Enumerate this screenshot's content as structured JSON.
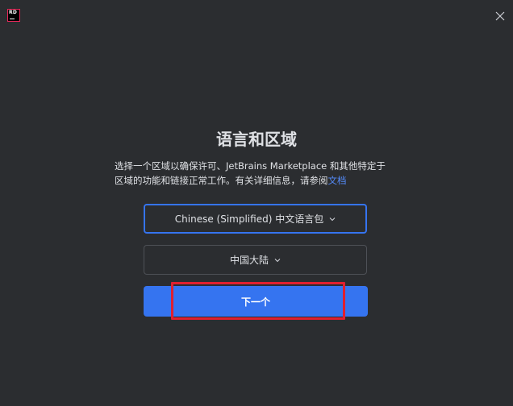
{
  "app": {
    "logo_text": "RD",
    "brand_color": "#e8285a"
  },
  "window": {
    "close_icon": "close-icon"
  },
  "page": {
    "title": "语言和区域",
    "description_line1": "选择一个区域以确保许可、JetBrains Marketplace 和其他特定于",
    "description_line2": "区域的功能和链接正常工作。有关详细信息，请参阅",
    "docs_link": "文档"
  },
  "language_select": {
    "value": "Chinese (Simplified) 中文语言包"
  },
  "region_select": {
    "value": "中国大陆"
  },
  "next_button": {
    "label": "下一个"
  },
  "colors": {
    "background": "#2b2d30",
    "accent": "#3574f0",
    "link": "#548af7",
    "highlight": "#e0202f"
  }
}
